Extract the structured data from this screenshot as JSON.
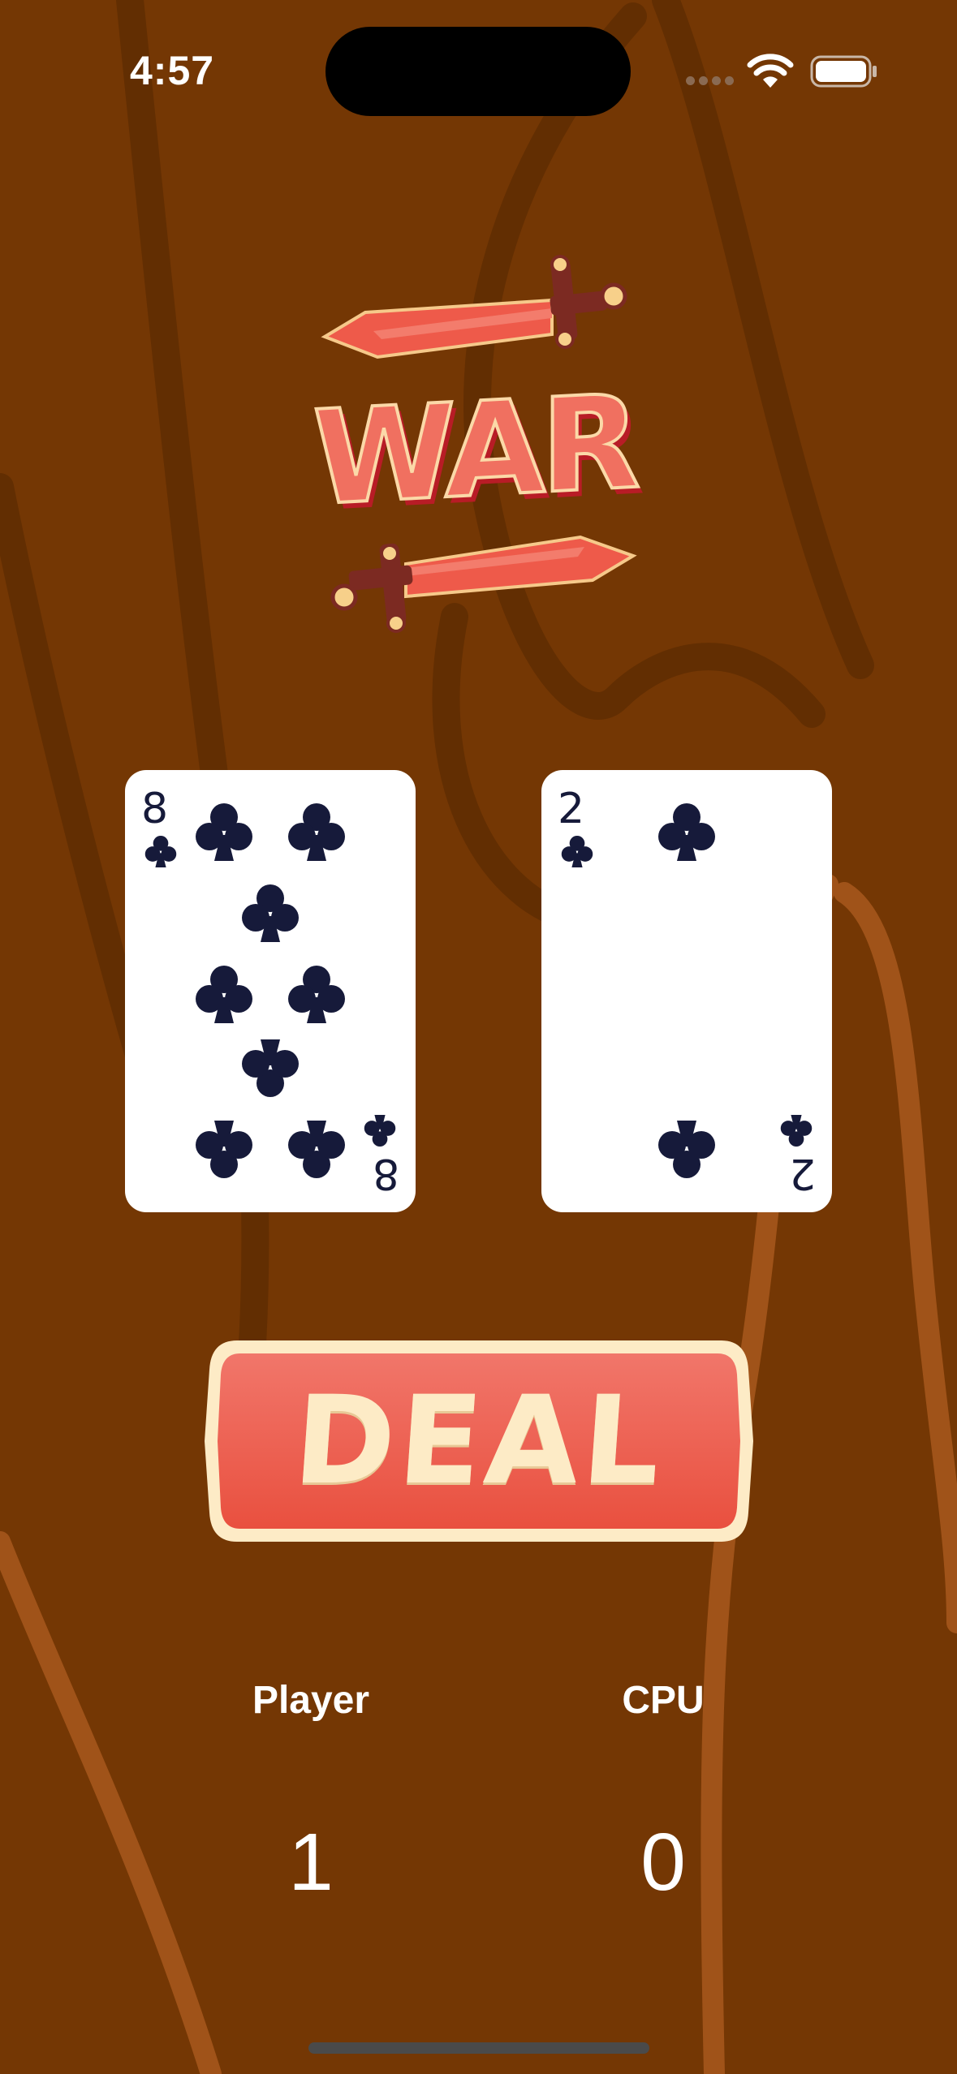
{
  "status_bar": {
    "time": "4:57"
  },
  "logo": {
    "text": "WAR"
  },
  "cards": {
    "player": {
      "rank": "8",
      "suit": "clubs",
      "suit_glyph": "♣"
    },
    "cpu": {
      "rank": "2",
      "suit": "clubs",
      "suit_glyph": "♣"
    }
  },
  "deal_button": {
    "label": "DEAL"
  },
  "scores": {
    "player_label": "Player",
    "player_value": "1",
    "cpu_label": "CPU",
    "cpu_value": "0"
  },
  "colors": {
    "background": "#743704",
    "button_red": "#ee5a4a",
    "button_cream": "#fdebc6",
    "card_ink": "#161a3a"
  }
}
